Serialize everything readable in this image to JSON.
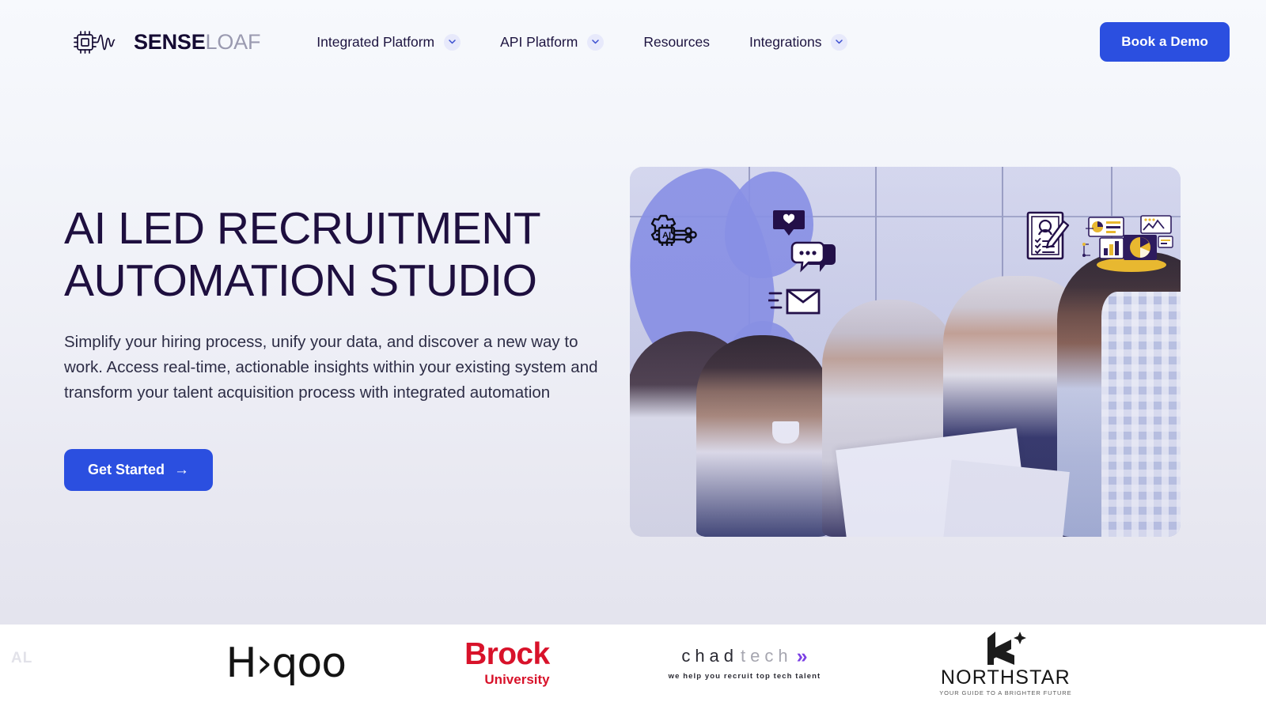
{
  "brand": {
    "name_bold": "SENSE",
    "name_light": "LOAF",
    "logo_icon": "chip-waveform-icon",
    "accent_color": "#2b4fe0",
    "dark_color": "#1e0f3f"
  },
  "nav": {
    "items": [
      {
        "label": "Integrated Platform",
        "has_dropdown": true,
        "icon": "chevron-down-icon"
      },
      {
        "label": "API Platform",
        "has_dropdown": true,
        "icon": "chevron-down-icon"
      },
      {
        "label": "Resources",
        "has_dropdown": false,
        "icon": ""
      },
      {
        "label": "Integrations",
        "has_dropdown": true,
        "icon": "chevron-down-icon"
      }
    ],
    "cta_label": "Book a Demo"
  },
  "hero": {
    "title_line1": "AI LED RECRUITMENT",
    "title_line2": "AUTOMATION STUDIO",
    "subtitle": "Simplify your hiring process, unify your data, and discover a new way to work. Access real-time, actionable insights within your existing system and transform your talent acquisition process with integrated automation",
    "cta_label": "Get Started",
    "cta_arrow": "→",
    "image_alt": "Team of recruiters collaborating in an office with AI automation icons overlaid",
    "overlay_icons": [
      "ai-gear-chip-icon",
      "heart-badge-icon",
      "chat-bubbles-icon",
      "envelope-send-icon",
      "resume-checklist-icon",
      "analytics-dashboard-icon"
    ]
  },
  "clients": {
    "items": [
      {
        "name": "Hyqoo",
        "display": "H›qoo",
        "tagline": "",
        "color": "#141414"
      },
      {
        "name": "Brock University",
        "display": "Brock",
        "tagline": "University",
        "color": "#d8122a"
      },
      {
        "name": "chadtech",
        "display_dark": "chad",
        "display_light": "tech",
        "tagline": "we help you recruit top tech talent",
        "color": "#7b3fe4"
      },
      {
        "name": "Northstar",
        "display": "NORTHSTAR",
        "tagline": "YOUR GUIDE TO A BRIGHTER FUTURE",
        "color": "#161616"
      }
    ]
  },
  "watermark": {
    "text": "AL"
  }
}
